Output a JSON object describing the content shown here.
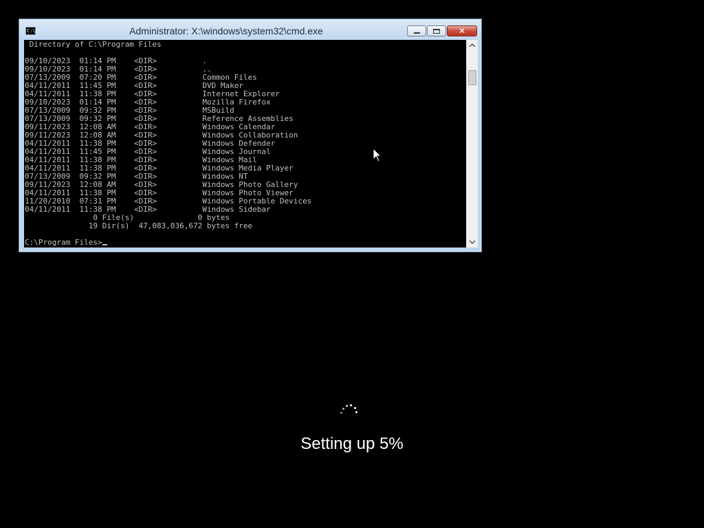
{
  "window": {
    "title": "Administrator: X:\\windows\\system32\\cmd.exe",
    "icon_text": "C:\\."
  },
  "console": {
    "header": " Directory of C:\\Program Files",
    "entries": [
      {
        "date": "09/10/2023",
        "time": "01:14 PM",
        "type": "<DIR>",
        "name": "."
      },
      {
        "date": "09/10/2023",
        "time": "01:14 PM",
        "type": "<DIR>",
        "name": ".."
      },
      {
        "date": "07/13/2009",
        "time": "07:20 PM",
        "type": "<DIR>",
        "name": "Common Files"
      },
      {
        "date": "04/11/2011",
        "time": "11:45 PM",
        "type": "<DIR>",
        "name": "DVD Maker"
      },
      {
        "date": "04/11/2011",
        "time": "11:38 PM",
        "type": "<DIR>",
        "name": "Internet Explorer"
      },
      {
        "date": "09/10/2023",
        "time": "01:14 PM",
        "type": "<DIR>",
        "name": "Mozilla Firefox"
      },
      {
        "date": "07/13/2009",
        "time": "09:32 PM",
        "type": "<DIR>",
        "name": "MSBuild"
      },
      {
        "date": "07/13/2009",
        "time": "09:32 PM",
        "type": "<DIR>",
        "name": "Reference Assemblies"
      },
      {
        "date": "09/11/2023",
        "time": "12:08 AM",
        "type": "<DIR>",
        "name": "Windows Calendar"
      },
      {
        "date": "09/11/2023",
        "time": "12:08 AM",
        "type": "<DIR>",
        "name": "Windows Collaboration"
      },
      {
        "date": "04/11/2011",
        "time": "11:38 PM",
        "type": "<DIR>",
        "name": "Windows Defender"
      },
      {
        "date": "04/11/2011",
        "time": "11:45 PM",
        "type": "<DIR>",
        "name": "Windows Journal"
      },
      {
        "date": "04/11/2011",
        "time": "11:38 PM",
        "type": "<DIR>",
        "name": "Windows Mail"
      },
      {
        "date": "04/11/2011",
        "time": "11:38 PM",
        "type": "<DIR>",
        "name": "Windows Media Player"
      },
      {
        "date": "07/13/2009",
        "time": "09:32 PM",
        "type": "<DIR>",
        "name": "Windows NT"
      },
      {
        "date": "09/11/2023",
        "time": "12:08 AM",
        "type": "<DIR>",
        "name": "Windows Photo Gallery"
      },
      {
        "date": "04/11/2011",
        "time": "11:38 PM",
        "type": "<DIR>",
        "name": "Windows Photo Viewer"
      },
      {
        "date": "11/20/2010",
        "time": "07:31 PM",
        "type": "<DIR>",
        "name": "Windows Portable Devices"
      },
      {
        "date": "04/11/2011",
        "time": "11:38 PM",
        "type": "<DIR>",
        "name": "Windows Sidebar"
      }
    ],
    "files_summary": "               0 File(s)              0 bytes",
    "dirs_summary": "              19 Dir(s)  47,083,036,672 bytes free",
    "prompt": "C:\\Program Files>"
  },
  "setup": {
    "status": "Setting up 5%",
    "progress_percent": 5
  },
  "icons": {
    "cmd": "cmd-icon",
    "minimize": "minimize-icon",
    "maximize": "maximize-icon",
    "close": "close-icon",
    "scroll_up": "chevron-up-icon",
    "scroll_down": "chevron-down-icon",
    "pointer": "mouse-pointer-icon",
    "spinner": "loading-spinner-icon"
  },
  "colors": {
    "background": "#000000",
    "console_text": "#c0c0c0",
    "close_button": "#c7483a"
  }
}
